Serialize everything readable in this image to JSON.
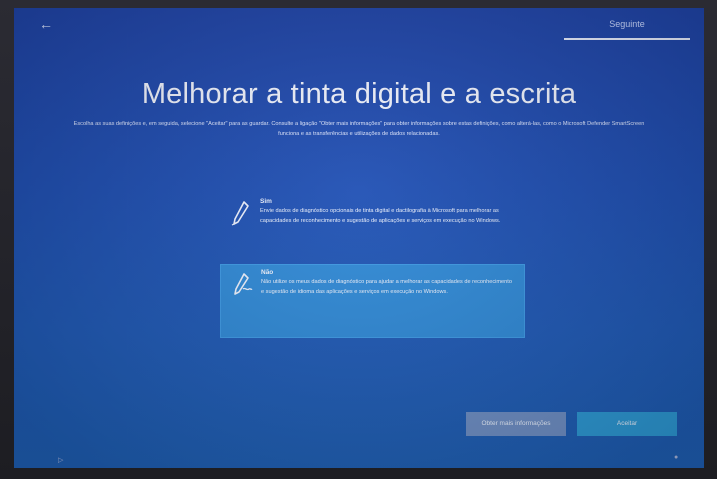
{
  "header": {
    "back_icon": "back-arrow-icon",
    "top_tab_label": "Seguinte"
  },
  "main": {
    "title": "Melhorar a tinta digital e a escrita",
    "subtitle": "Escolha as suas definições e, em seguida, selecione \"Aceitar\" para as guardar. Consulte a ligação \"Obter mais informações\" para obter informações sobre estas definições, como alterá-las, como o Microsoft Defender SmartScreen funciona e as transferências e utilizações de dados relacionadas."
  },
  "options": [
    {
      "icon": "pen-icon",
      "title": "Sim",
      "description": "Envie dados de diagnóstico opcionais de tinta digital e dactilografia à Microsoft para melhorar as capacidades de reconhecimento e sugestão de aplicações e serviços em execução no Windows."
    },
    {
      "icon": "pen-off-icon",
      "title": "Não",
      "description": "Não utilize os meus dados de diagnóstico para ajudar a melhorar as capacidades de reconhecimento e sugestão de idioma das aplicações e serviços em execução no Windows."
    }
  ],
  "buttons": {
    "more_info": "Obter mais informações",
    "accept": "Aceitar"
  },
  "colors": {
    "background": "#1f4fb4",
    "selected_option": "#2f8ad8",
    "accept_button": "#2d9ad7",
    "secondary_button": "#6e8fc6"
  }
}
